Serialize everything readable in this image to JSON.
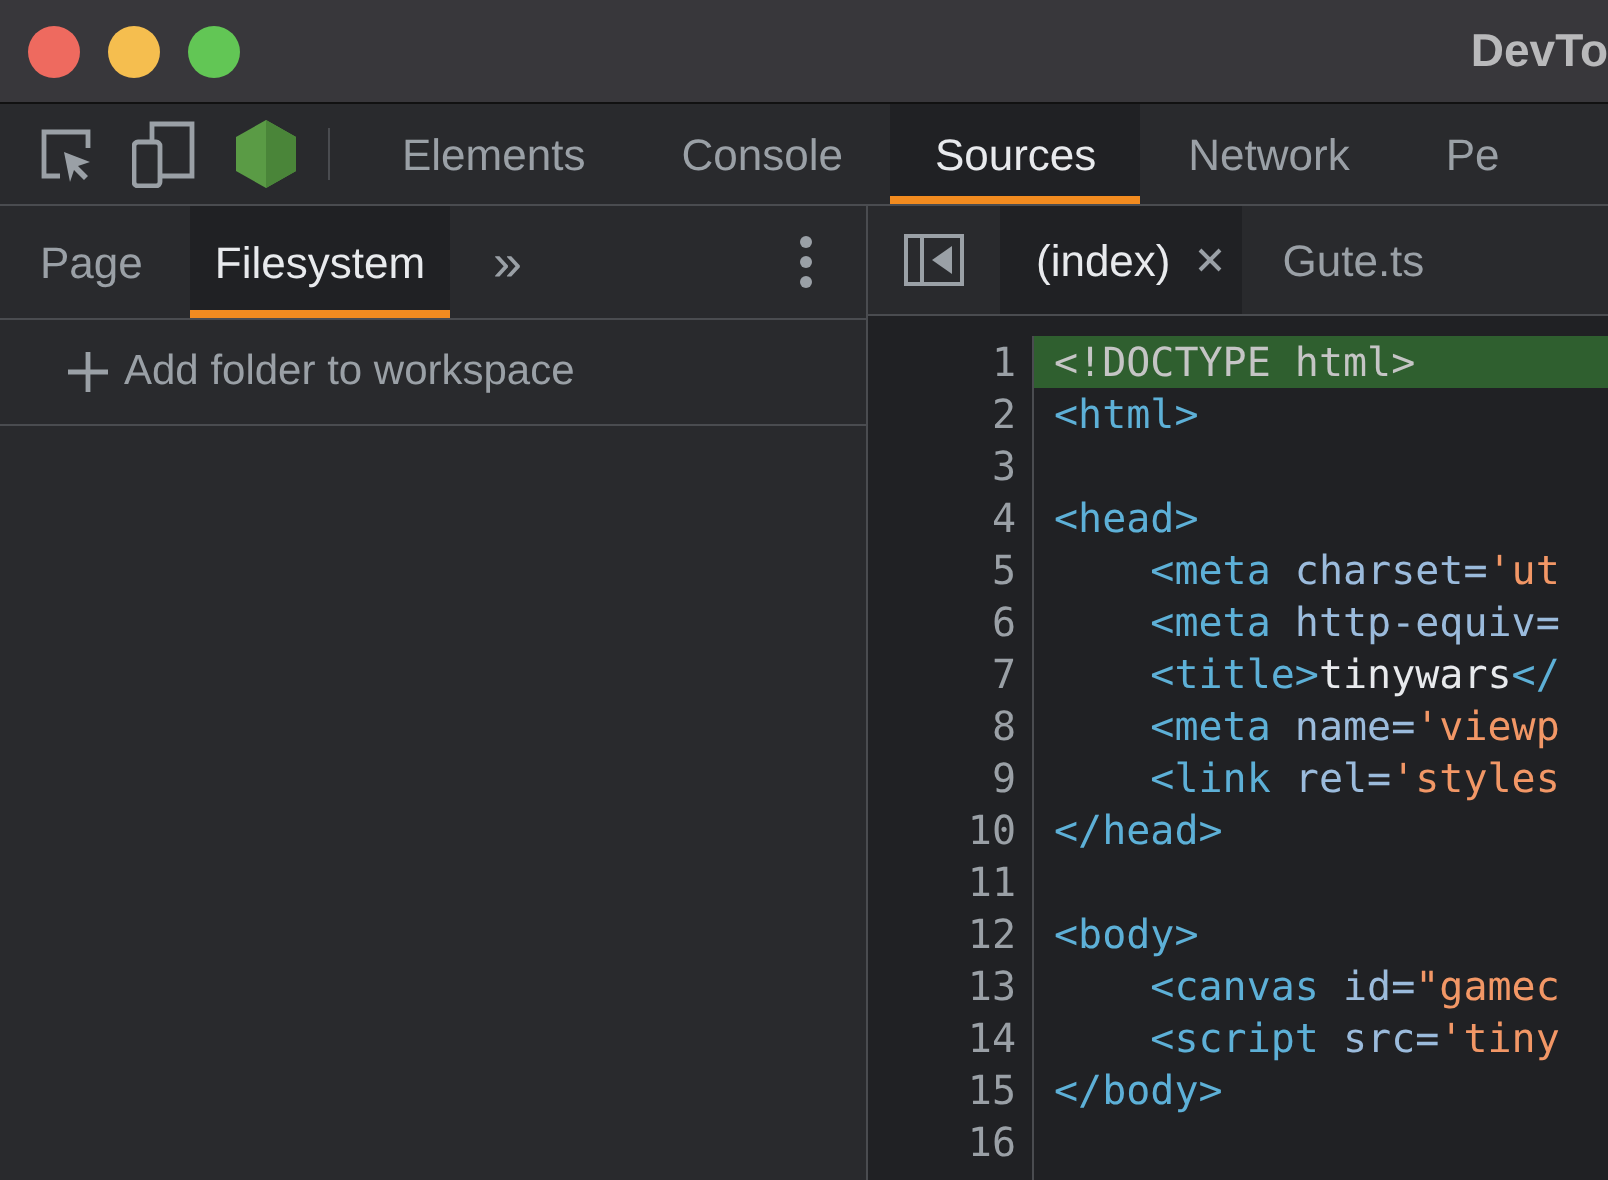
{
  "window": {
    "title": "DevTo"
  },
  "main_tabs": [
    {
      "label": "Elements",
      "selected": false
    },
    {
      "label": "Console",
      "selected": false
    },
    {
      "label": "Sources",
      "selected": true
    },
    {
      "label": "Network",
      "selected": false
    },
    {
      "label": "Pe",
      "selected": false
    }
  ],
  "navigator": {
    "tabs": [
      {
        "label": "Page",
        "selected": false
      },
      {
        "label": "Filesystem",
        "selected": true
      }
    ],
    "more": "»",
    "action": "Add folder to workspace"
  },
  "editor_tabs": [
    {
      "label": "(index)",
      "selected": true,
      "closable": true
    },
    {
      "label": "Gute.ts",
      "selected": false,
      "closable": false
    }
  ],
  "code_lines": [
    {
      "number": "1",
      "highlighted": true,
      "tokens": [
        {
          "kind": "doctype",
          "text": "<!DOCTYPE html>"
        }
      ]
    },
    {
      "number": "2",
      "highlighted": false,
      "tokens": [
        {
          "kind": "tag",
          "text": "<html>"
        }
      ]
    },
    {
      "number": "3",
      "highlighted": false
    },
    {
      "number": "4",
      "highlighted": false,
      "tokens": [
        {
          "kind": "tag",
          "text": "<head>"
        }
      ]
    },
    {
      "number": "5",
      "highlighted": false,
      "tokens": [
        {
          "kind": "tag",
          "text": "    <meta"
        },
        {
          "kind": "attr",
          "text": " charset="
        },
        {
          "kind": "value",
          "text": "'ut"
        }
      ]
    },
    {
      "number": "6",
      "highlighted": false,
      "tokens": [
        {
          "kind": "tag",
          "text": "    <meta"
        },
        {
          "kind": "attr",
          "text": " http-equiv="
        }
      ]
    },
    {
      "number": "7",
      "highlighted": false,
      "tokens": [
        {
          "kind": "tag",
          "text": "    <title>"
        },
        {
          "kind": "text",
          "text": "tinywars"
        },
        {
          "kind": "tag",
          "text": "</"
        }
      ]
    },
    {
      "number": "8",
      "highlighted": false,
      "tokens": [
        {
          "kind": "tag",
          "text": "    <meta"
        },
        {
          "kind": "attr",
          "text": " name="
        },
        {
          "kind": "value",
          "text": "'viewp"
        }
      ]
    },
    {
      "number": "9",
      "highlighted": false,
      "tokens": [
        {
          "kind": "tag",
          "text": "    <link"
        },
        {
          "kind": "attr",
          "text": " rel="
        },
        {
          "kind": "value",
          "text": "'styles"
        }
      ]
    },
    {
      "number": "10",
      "highlighted": false,
      "tokens": [
        {
          "kind": "tag",
          "text": "</head>"
        }
      ]
    },
    {
      "number": "11",
      "highlighted": false
    },
    {
      "number": "12",
      "highlighted": false,
      "tokens": [
        {
          "kind": "tag",
          "text": "<body>"
        }
      ]
    },
    {
      "number": "13",
      "highlighted": false,
      "tokens": [
        {
          "kind": "tag",
          "text": "    <canvas"
        },
        {
          "kind": "attr",
          "text": " id="
        },
        {
          "kind": "value",
          "text": "\"gamec"
        }
      ]
    },
    {
      "number": "14",
      "highlighted": false,
      "tokens": [
        {
          "kind": "tag",
          "text": "    <script"
        },
        {
          "kind": "attr",
          "text": " src="
        },
        {
          "kind": "value",
          "text": "'tiny"
        }
      ]
    },
    {
      "number": "15",
      "highlighted": false,
      "tokens": [
        {
          "kind": "tag",
          "text": "</body>"
        }
      ]
    },
    {
      "number": "16",
      "highlighted": false
    }
  ]
}
